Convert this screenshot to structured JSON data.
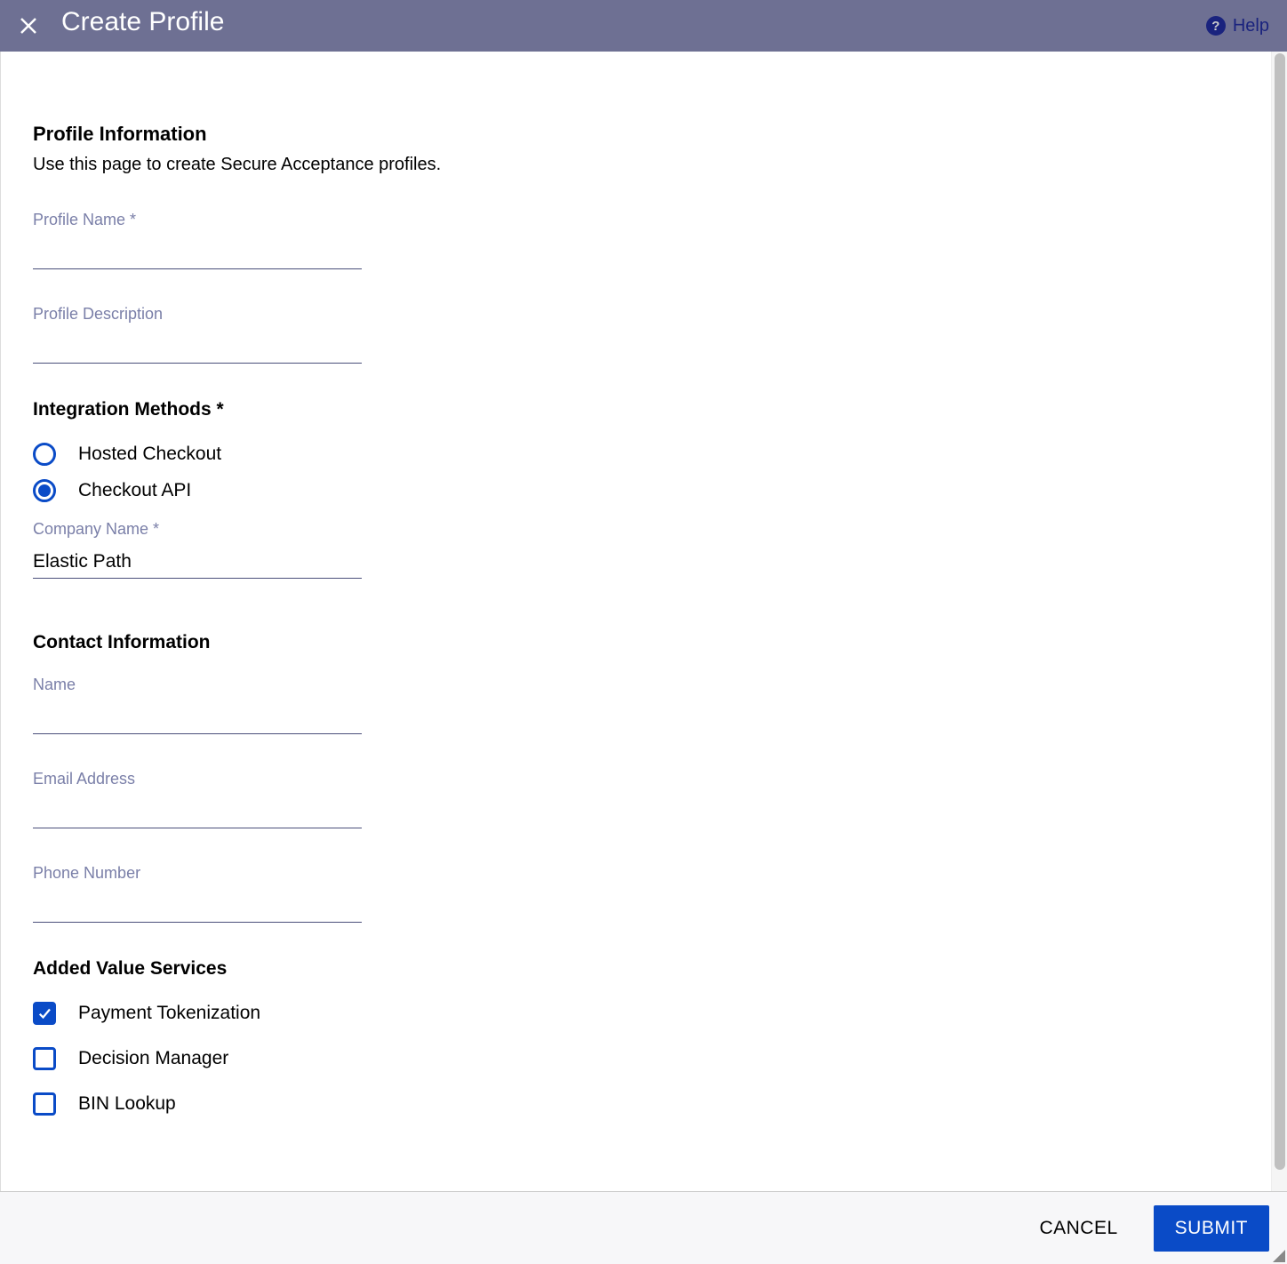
{
  "header": {
    "title": "Create Profile",
    "help_label": "Help"
  },
  "profile_info": {
    "section_title": "Profile Information",
    "section_subtitle": "Use this page to create Secure Acceptance profiles.",
    "profile_name_label": "Profile Name *",
    "profile_name_value": "",
    "profile_description_label": "Profile Description",
    "profile_description_value": ""
  },
  "integration": {
    "heading": "Integration Methods *",
    "options": [
      {
        "label": "Hosted Checkout",
        "selected": false
      },
      {
        "label": "Checkout API",
        "selected": true
      }
    ],
    "company_name_label": "Company Name *",
    "company_name_value": "Elastic Path"
  },
  "contact": {
    "heading": "Contact Information",
    "name_label": "Name",
    "name_value": "",
    "email_label": "Email Address",
    "email_value": "",
    "phone_label": "Phone Number",
    "phone_value": ""
  },
  "services": {
    "heading": "Added Value Services",
    "options": [
      {
        "label": "Payment Tokenization",
        "checked": true
      },
      {
        "label": "Decision Manager",
        "checked": false
      },
      {
        "label": "BIN Lookup",
        "checked": false
      }
    ]
  },
  "footer": {
    "cancel_label": "CANCEL",
    "submit_label": "SUBMIT"
  }
}
